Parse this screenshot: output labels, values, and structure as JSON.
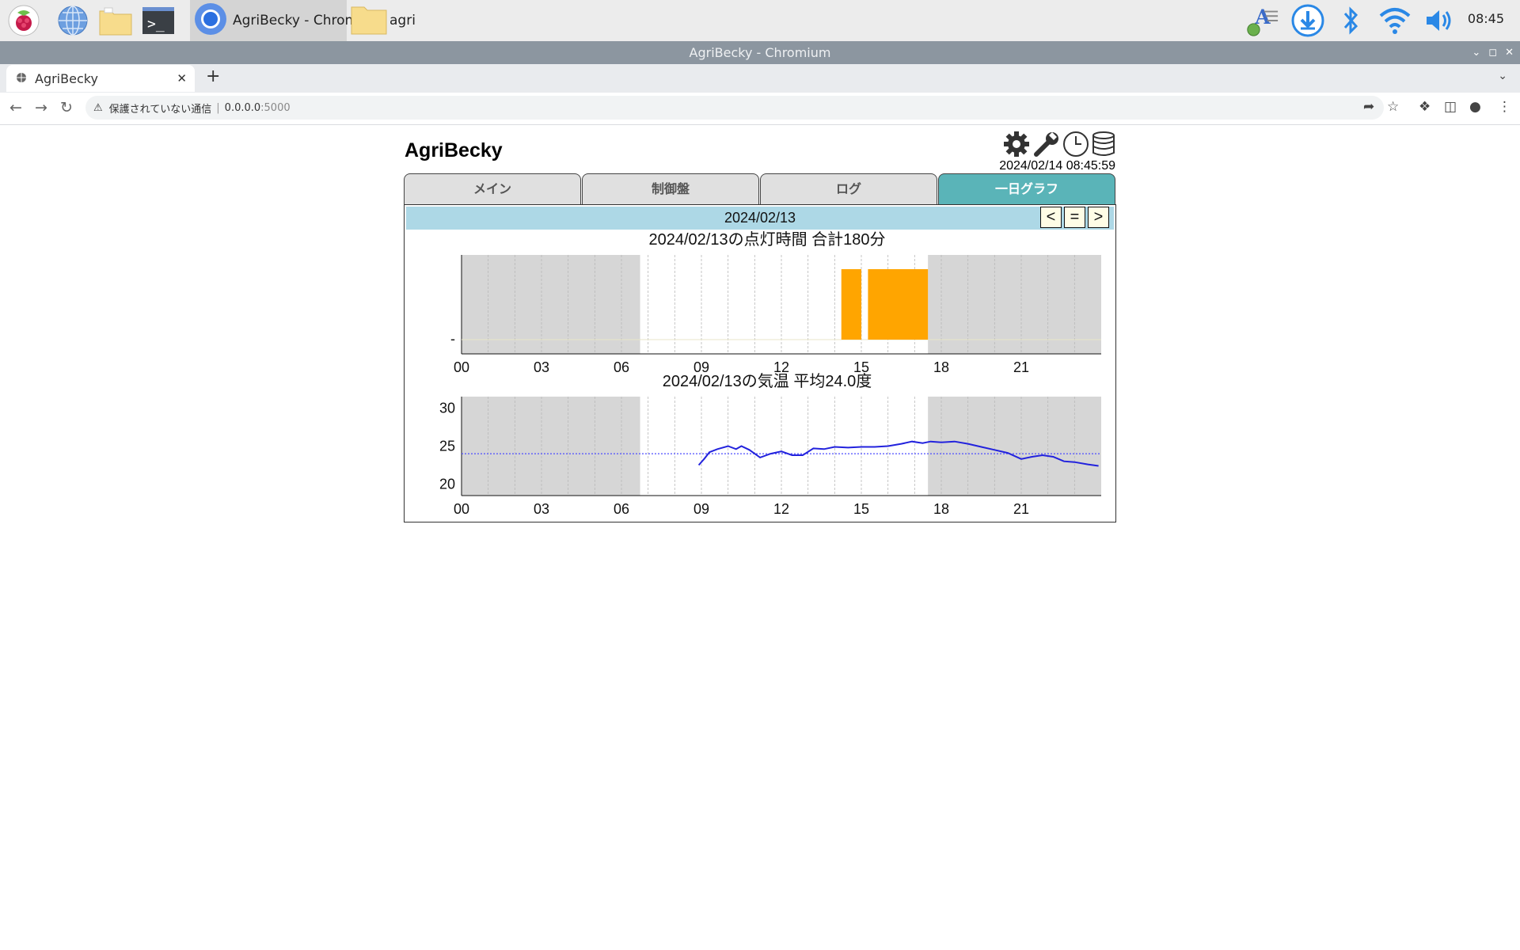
{
  "taskbar": {
    "tasks": [
      {
        "label": "AgriBecky - Chromi...",
        "icon": "chromium-icon",
        "active": true
      },
      {
        "label": "agri",
        "icon": "folder-icon",
        "active": false
      }
    ],
    "clock": "08:45"
  },
  "window": {
    "title": "AgriBecky - Chromium"
  },
  "browser": {
    "tab_title": "AgriBecky",
    "security_label": "保護されていない通信",
    "url_host": "0.0.0.0",
    "url_port": ":5000"
  },
  "app": {
    "title": "AgriBecky",
    "datetime": "2024/02/14 08:45:59",
    "icons": [
      "gear-icon",
      "wrench-icon",
      "clock-icon",
      "database-icon"
    ],
    "tabs": [
      {
        "label": "メイン",
        "active": false
      },
      {
        "label": "制御盤",
        "active": false
      },
      {
        "label": "ログ",
        "active": false
      },
      {
        "label": "一日グラフ",
        "active": true
      }
    ],
    "date": "2024/02/13",
    "nav": {
      "prev": "<",
      "today": "=",
      "next": ">"
    }
  },
  "chart_data": [
    {
      "type": "bar",
      "title": "2024/02/13の点灯時間 合計180分",
      "x_ticks": [
        "00",
        "03",
        "06",
        "09",
        "12",
        "15",
        "18",
        "21"
      ],
      "y_ticks": [
        "-"
      ],
      "xlim": [
        0,
        24
      ],
      "night_shading_hours": [
        [
          0,
          6.7
        ],
        [
          17.5,
          24
        ]
      ],
      "series": [
        {
          "color": "#ffa500",
          "intervals_hours": [
            [
              14.25,
              15.0
            ],
            [
              15.25,
              17.5
            ]
          ]
        }
      ]
    },
    {
      "type": "line",
      "title": "2024/02/13の気温 平均24.0度",
      "x_ticks": [
        "00",
        "03",
        "06",
        "09",
        "12",
        "15",
        "18",
        "21"
      ],
      "y_ticks": [
        "30",
        "25",
        "20"
      ],
      "xlim": [
        0,
        24
      ],
      "ylim": [
        18.5,
        31.5
      ],
      "night_shading_hours": [
        [
          0,
          6.7
        ],
        [
          17.5,
          24
        ]
      ],
      "average": 24.0,
      "average_color": "#4d4dff",
      "line_color": "#2222dd",
      "series": [
        {
          "x": [
            8.9,
            9.1,
            9.3,
            9.6,
            10.0,
            10.3,
            10.5,
            10.8,
            11.2,
            11.6,
            12.0,
            12.4,
            12.8,
            13.2,
            13.6,
            14.0,
            14.5,
            15.0,
            15.5,
            16.0,
            16.5,
            16.9,
            17.3,
            17.6,
            18.0,
            18.5,
            19.0,
            19.5,
            20.0,
            20.5,
            21.0,
            21.4,
            21.8,
            22.2,
            22.6,
            23.0,
            23.5,
            23.9
          ],
          "y": [
            22.5,
            23.3,
            24.2,
            24.6,
            25.0,
            24.6,
            25.0,
            24.5,
            23.5,
            24.0,
            24.3,
            23.8,
            23.8,
            24.7,
            24.6,
            24.9,
            24.8,
            24.9,
            24.9,
            25.0,
            25.3,
            25.6,
            25.4,
            25.6,
            25.5,
            25.6,
            25.3,
            24.9,
            24.5,
            24.1,
            23.3,
            23.6,
            23.8,
            23.6,
            23.0,
            22.9,
            22.6,
            22.4
          ]
        }
      ]
    }
  ]
}
